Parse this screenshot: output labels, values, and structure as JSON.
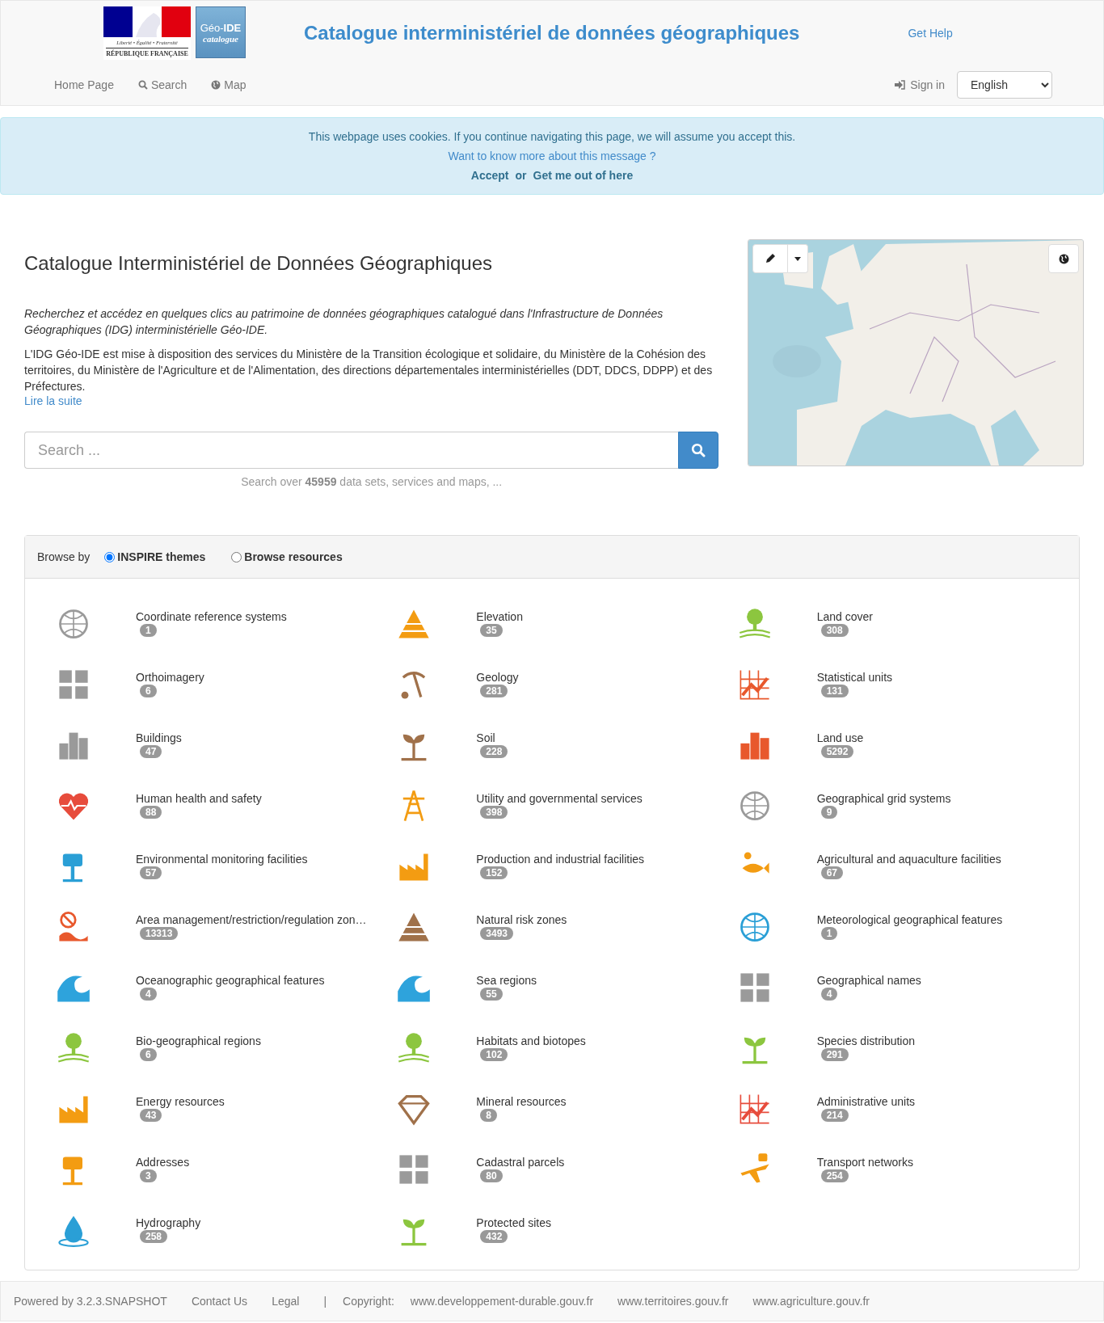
{
  "logo": {
    "motto": "Liberté • Égalité • Fraternité",
    "republic": "RÉPUBLIQUE FRANÇAISE",
    "badge_title": "Géo-**IDE**",
    "badge_subtitle": "catalogue"
  },
  "site_title": "Catalogue interministériel de données géographiques",
  "help_link": "Get Help",
  "nav": [
    {
      "label": "Home Page"
    },
    {
      "label": "Search"
    },
    {
      "label": "Map"
    }
  ],
  "sign_in": "Sign in",
  "language": "English",
  "cookie_banner": {
    "message": "This webpage uses cookies. If you continue navigating this page, we will assume you accept this.",
    "more_link": "Want to know more about this message ?",
    "accept": "Accept",
    "or": "or",
    "leave": "Get me out of here"
  },
  "heading": "Catalogue Interministériel de Données Géographiques",
  "intro": "Recherchez et accédez en quelques clics au patrimoine de données géographiques catalogué dans l'Infrastructure de Données Géographiques (IDG) interministérielle Géo-IDE.",
  "description": "L'IDG Géo-IDE est mise à disposition des services du Ministère de la Transition écologique et solidaire, du Ministère de la Cohésion des territoires, du Ministère de l'Agriculture et de l'Alimentation, des directions départementales interministérielles (DDT, DDCS, DDPP) et des Préfectures.",
  "read_more": "Lire la suite",
  "search": {
    "placeholder": "Search ...",
    "hint": "Search over **45959** data sets, services and maps, ..."
  },
  "browse": {
    "label": "Browse by",
    "options": [
      {
        "label": "INSPIRE themes",
        "selected": true
      },
      {
        "label": "Browse resources",
        "selected": false
      }
    ]
  },
  "themes": [
    {
      "label": "Coordinate reference systems",
      "count": "1",
      "color": "#9a9a9a"
    },
    {
      "label": "Elevation",
      "count": "35",
      "color": "#f39c12"
    },
    {
      "label": "Land cover",
      "count": "308",
      "color": "#8cc63f"
    },
    {
      "label": "Orthoimagery",
      "count": "6",
      "color": "#9a9a9a"
    },
    {
      "label": "Geology",
      "count": "281",
      "color": "#a0714a"
    },
    {
      "label": "Statistical units",
      "count": "131",
      "color": "#e8582c"
    },
    {
      "label": "Buildings",
      "count": "47",
      "color": "#9a9a9a"
    },
    {
      "label": "Soil",
      "count": "228",
      "color": "#a0714a"
    },
    {
      "label": "Land use",
      "count": "5292",
      "color": "#e8582c"
    },
    {
      "label": "Human health and safety",
      "count": "88",
      "color": "#e74c3c"
    },
    {
      "label": "Utility and governmental services",
      "count": "398",
      "color": "#f39c12"
    },
    {
      "label": "Geographical grid systems",
      "count": "9",
      "color": "#9a9a9a"
    },
    {
      "label": "Environmental monitoring facilities",
      "count": "57",
      "color": "#2a9fd6"
    },
    {
      "label": "Production and industrial facilities",
      "count": "152",
      "color": "#f39c12"
    },
    {
      "label": "Agricultural and aquaculture facilities",
      "count": "67",
      "color": "#f39c12"
    },
    {
      "label": "Area management/restriction/regulation zon…",
      "count": "13313",
      "color": "#e8582c"
    },
    {
      "label": "Natural risk zones",
      "count": "3493",
      "color": "#a0714a"
    },
    {
      "label": "Meteorological geographical features",
      "count": "1",
      "color": "#2a9fd6"
    },
    {
      "label": "Oceanographic geographical features",
      "count": "4",
      "color": "#2ea3dc"
    },
    {
      "label": "Sea regions",
      "count": "55",
      "color": "#2ea3dc"
    },
    {
      "label": "Geographical names",
      "count": "4",
      "color": "#9a9a9a"
    },
    {
      "label": "Bio-geographical regions",
      "count": "6",
      "color": "#8cc63f"
    },
    {
      "label": "Habitats and biotopes",
      "count": "102",
      "color": "#8cc63f"
    },
    {
      "label": "Species distribution",
      "count": "291",
      "color": "#8cc63f"
    },
    {
      "label": "Energy resources",
      "count": "43",
      "color": "#f39c12"
    },
    {
      "label": "Mineral resources",
      "count": "8",
      "color": "#a0714a"
    },
    {
      "label": "Administrative units",
      "count": "214",
      "color": "#e74c3c"
    },
    {
      "label": "Addresses",
      "count": "3",
      "color": "#f39c12"
    },
    {
      "label": "Cadastral parcels",
      "count": "80",
      "color": "#9a9a9a"
    },
    {
      "label": "Transport networks",
      "count": "254",
      "color": "#f39c12"
    },
    {
      "label": "Hydrography",
      "count": "258",
      "color": "#2a9fd6"
    },
    {
      "label": "Protected sites",
      "count": "432",
      "color": "#8cc63f"
    }
  ],
  "footer": [
    {
      "label": "Powered by 3.2.3.SNAPSHOT",
      "kind": "link"
    },
    {
      "label": "Contact Us",
      "kind": "link"
    },
    {
      "label": "Legal",
      "kind": "link"
    },
    {
      "label": "|",
      "kind": "text"
    },
    {
      "label": "Copyright:",
      "kind": "text"
    },
    {
      "label": "www.developpement-durable.gouv.fr",
      "kind": "link"
    },
    {
      "label": "www.territoires.gouv.fr",
      "kind": "link"
    },
    {
      "label": "www.agriculture.gouv.fr",
      "kind": "link"
    }
  ]
}
